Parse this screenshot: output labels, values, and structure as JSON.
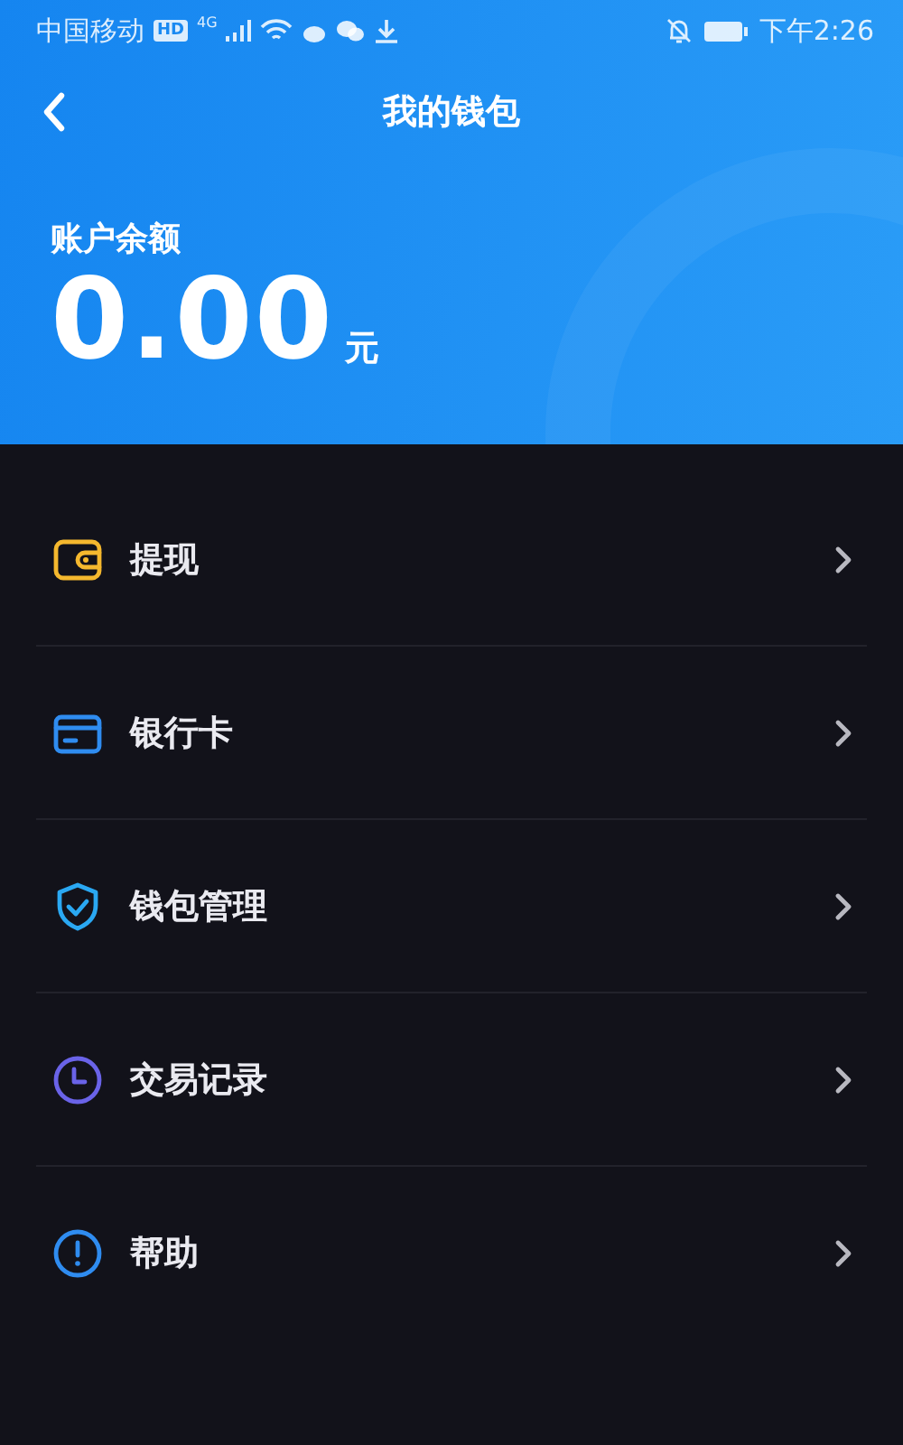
{
  "status_bar": {
    "carrier": "中国移动",
    "hd_badge": "HD",
    "network": "4G",
    "time": "下午2:26"
  },
  "header": {
    "title": "我的钱包"
  },
  "balance": {
    "label": "账户余额",
    "amount": "0.00",
    "unit": "元"
  },
  "menu": [
    {
      "label": "提现",
      "kind": "wallet",
      "color": "#f5b82e"
    },
    {
      "label": "银行卡",
      "kind": "card",
      "color": "#2f8cf0"
    },
    {
      "label": "钱包管理",
      "kind": "shield",
      "color": "#2aa8f2"
    },
    {
      "label": "交易记录",
      "kind": "clock",
      "color": "#6a63e8"
    },
    {
      "label": "帮助",
      "kind": "alert",
      "color": "#2f8cf0"
    }
  ]
}
